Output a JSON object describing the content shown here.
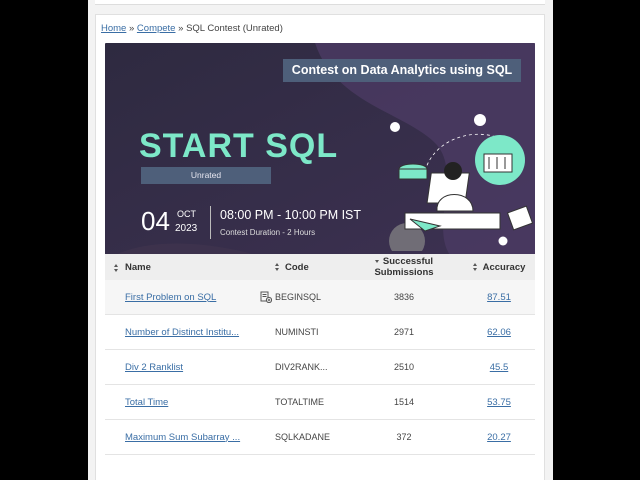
{
  "breadcrumb": {
    "home": "Home",
    "sep1": "»",
    "compete": "Compete",
    "sep2": "»",
    "current": "SQL Contest (Unrated)"
  },
  "banner": {
    "title": "Contest on Data Analytics using SQL",
    "headline": "START SQL",
    "badge": "Unrated",
    "day": "04",
    "month": "OCT",
    "year": "2023",
    "time": "08:00 PM - 10:00 PM IST",
    "duration": "Contest Duration - 2 Hours",
    "colors": {
      "bg": "#3a2f4f",
      "accent": "#7de8c8"
    }
  },
  "table": {
    "headers": {
      "name": "Name",
      "code": "Code",
      "submissions": "Successful Submissions",
      "accuracy": "Accuracy"
    },
    "rows": [
      {
        "name": "First Problem on SQL",
        "code": "BEGINSQL",
        "submissions": "3836",
        "accuracy": "87.51",
        "icon": "add-to-list-icon"
      },
      {
        "name": "Number of Distinct Institu...",
        "code": "NUMINSTI",
        "submissions": "2971",
        "accuracy": "62.06"
      },
      {
        "name": "Div 2 Ranklist",
        "code": "DIV2RANK...",
        "submissions": "2510",
        "accuracy": "45.5"
      },
      {
        "name": "Total Time",
        "code": "TOTALTIME",
        "submissions": "1514",
        "accuracy": "53.75"
      },
      {
        "name": "Maximum Sum Subarray ...",
        "code": "SQLKADANE",
        "submissions": "372",
        "accuracy": "20.27"
      }
    ]
  }
}
